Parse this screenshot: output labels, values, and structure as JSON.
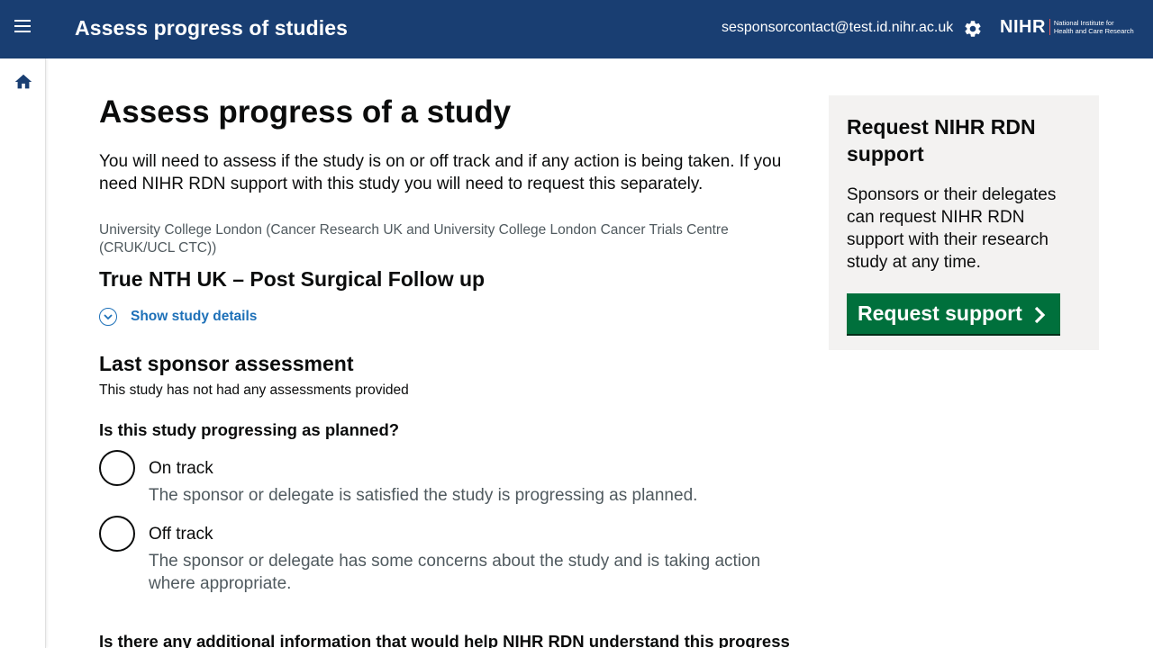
{
  "header": {
    "app_title": "Assess progress of studies",
    "user_email": "sesponsorcontact@test.id.nihr.ac.uk",
    "logo_mark": "NIHR",
    "logo_line1": "National Institute for",
    "logo_line2": "Health and Care Research",
    "menu_icon": "hamburger-menu-icon",
    "settings_icon": "gear-icon"
  },
  "sidebar": {
    "home_icon": "home-icon"
  },
  "main": {
    "page_title": "Assess progress of a study",
    "intro": "You will need to assess if the study is on or off track and if any action is being taken. If you need NIHR RDN support with this study you will need to request this separately.",
    "organisation": "University College London (Cancer Research UK and University College London Cancer Trials Centre (CRUK/UCL CTC))",
    "study_title": "True NTH UK – Post Surgical Follow up",
    "show_details_label": "Show study details",
    "last_assessment_heading": "Last sponsor assessment",
    "last_assessment_text": "This study has not had any assessments provided",
    "question": "Is this study progressing as planned?",
    "options": [
      {
        "label": "On track",
        "hint": "The sponsor or delegate is satisfied the study is progressing as planned."
      },
      {
        "label": "Off track",
        "hint": "The sponsor or delegate has some concerns about the study and is taking action where appropriate."
      }
    ],
    "question2": "Is there any additional information that would help NIHR RDN understand this progress"
  },
  "aside": {
    "title": "Request NIHR RDN support",
    "text": "Sponsors or their delegates can request NIHR RDN support with their research study at any time.",
    "button_label": "Request support"
  },
  "colors": {
    "header_bg": "#193e72",
    "link": "#1d70b8",
    "button": "#00703c",
    "aside_bg": "#f3f2f1"
  }
}
